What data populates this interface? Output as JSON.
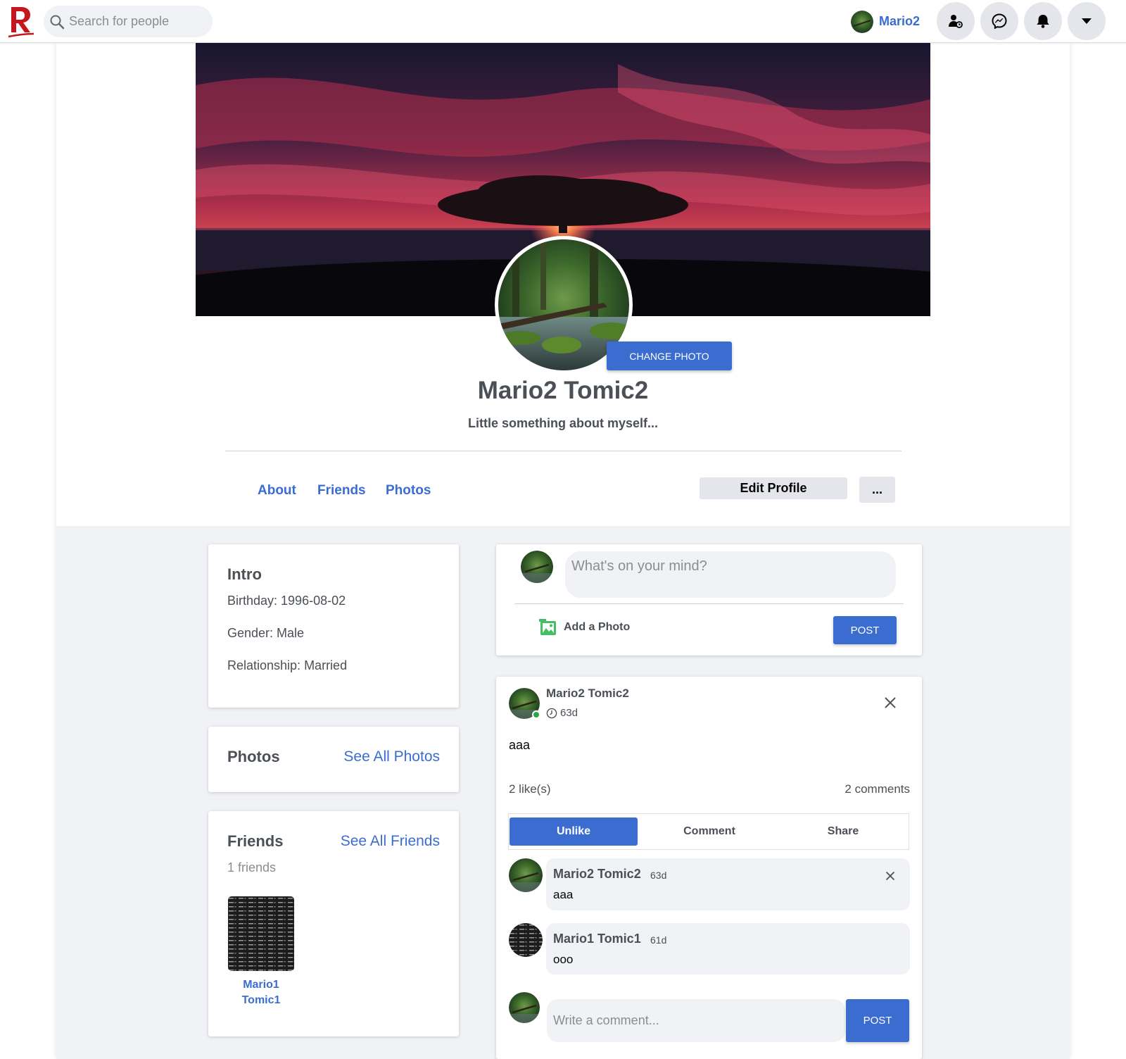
{
  "topnav": {
    "search_placeholder": "Search for people",
    "user_name": "Mario2",
    "icons": [
      "friend-requests-icon",
      "messenger-icon",
      "notifications-icon",
      "caret-down-icon"
    ]
  },
  "profile": {
    "name": "Mario2 Tomic2",
    "bio": "Little something about myself...",
    "change_photo_label": "CHANGE PHOTO",
    "tabs": [
      {
        "label": "About"
      },
      {
        "label": "Friends"
      },
      {
        "label": "Photos"
      }
    ],
    "edit_profile_label": "Edit Profile",
    "more_label": "..."
  },
  "intro": {
    "title": "Intro",
    "birthday": "Birthday: 1996-08-02",
    "gender": "Gender: Male",
    "relationship": "Relationship: Married"
  },
  "photos_card": {
    "title": "Photos",
    "see_all": "See All Photos"
  },
  "friends_card": {
    "title": "Friends",
    "see_all": "See All Friends",
    "count": "1 friends",
    "friends": [
      {
        "first": "Mario1",
        "last": "Tomic1"
      }
    ]
  },
  "composer": {
    "placeholder": "What's on your mind?",
    "add_photo_label": "Add a Photo",
    "post_label": "POST"
  },
  "post": {
    "author": "Mario2 Tomic2",
    "time": "63d",
    "text": "aaa",
    "likes": "2 like(s)",
    "comments_count": "2 comments",
    "actions": [
      "Unlike",
      "Comment",
      "Share"
    ],
    "comments": [
      {
        "author": "Mario2 Tomic2",
        "time": "63d",
        "text": "aaa"
      },
      {
        "author": "Mario1 Tomic1",
        "time": "61d",
        "text": "ooo"
      }
    ],
    "write_placeholder": "Write a comment...",
    "comment_post_label": "POST"
  },
  "colors": {
    "accent": "#3b6dd0",
    "brand_red": "#c4161c",
    "page_bg": "#f0f2f5",
    "online": "#31a24c"
  }
}
